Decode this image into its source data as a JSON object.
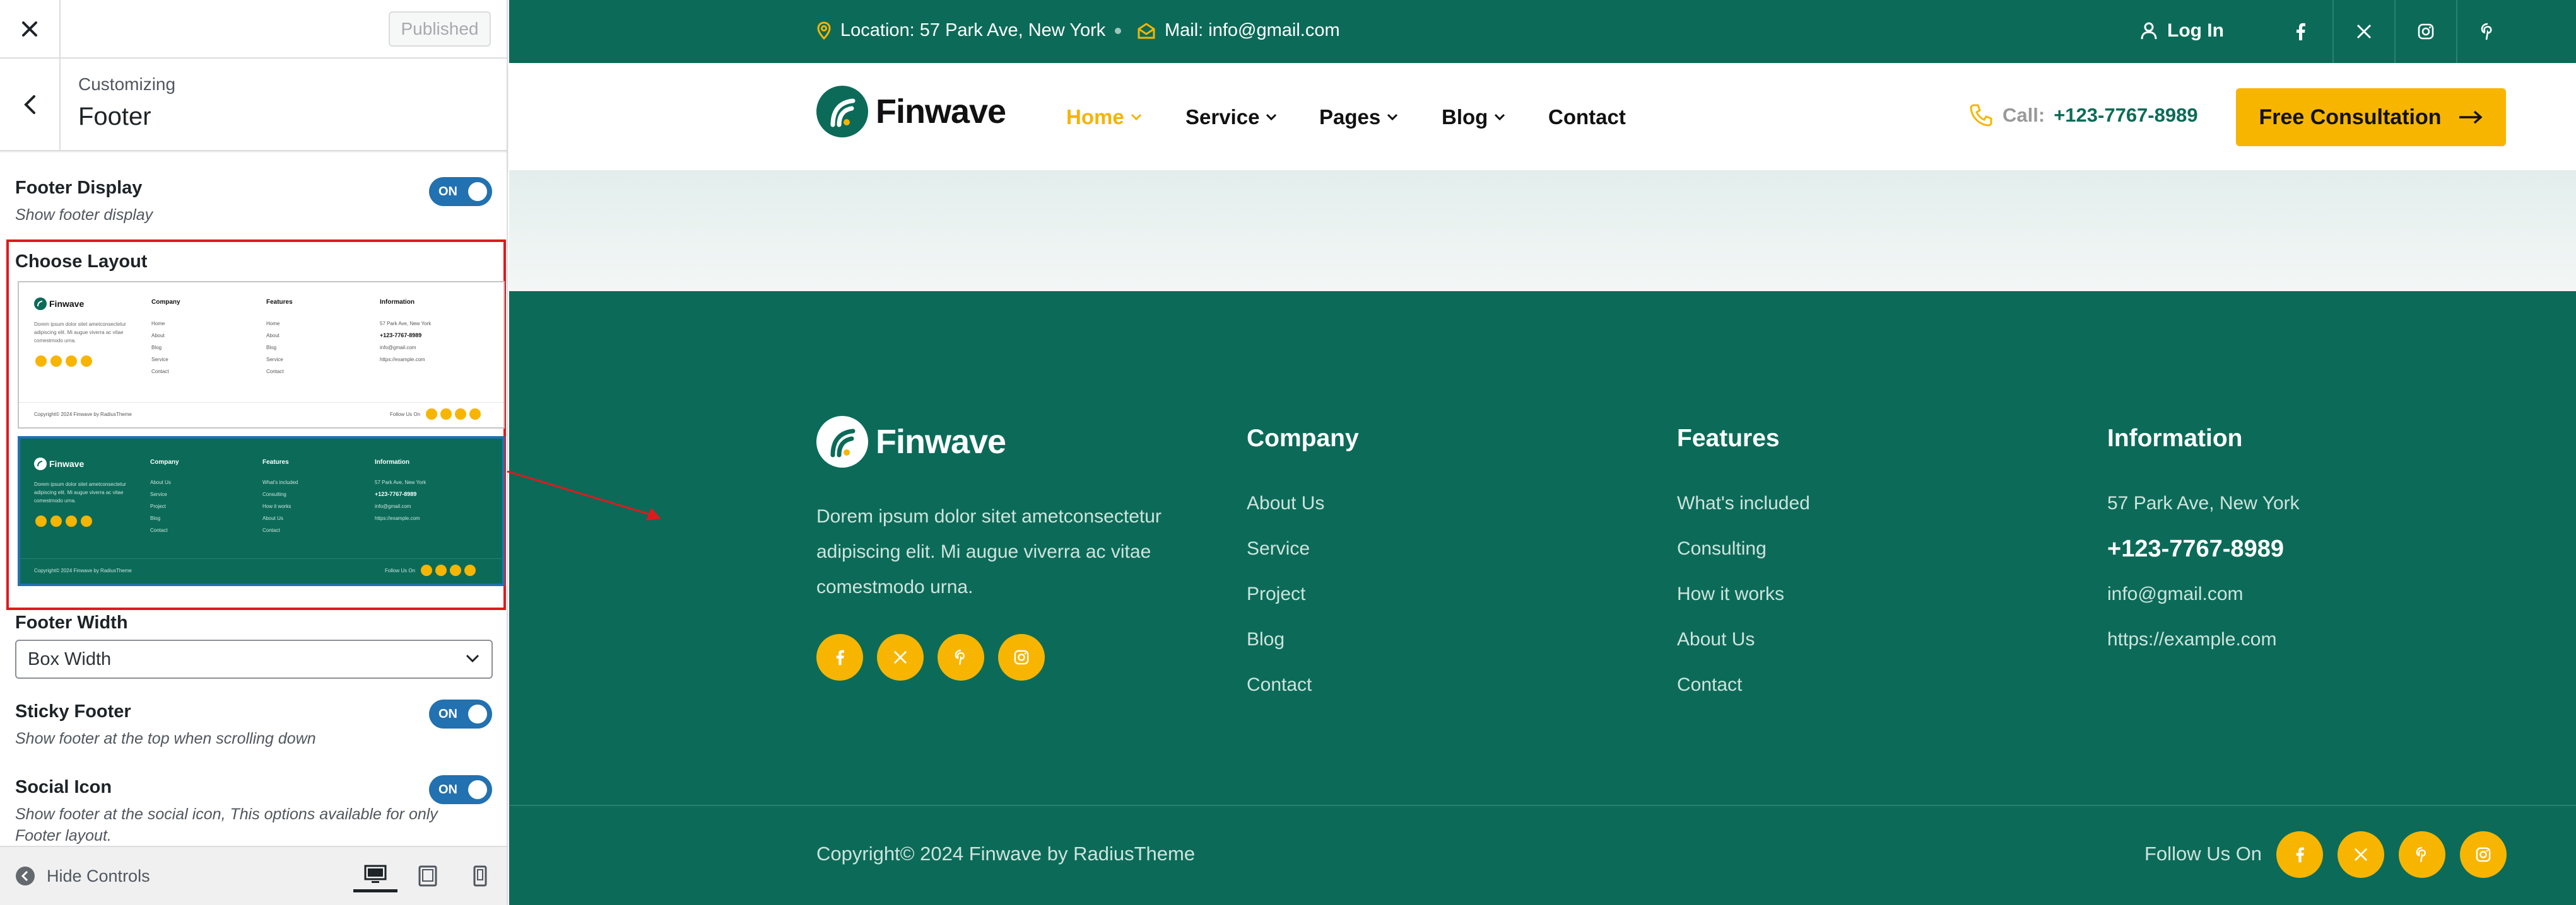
{
  "customizer": {
    "published_label": "Published",
    "breadcrumb": "Customizing",
    "section_title": "Footer",
    "options": {
      "footer_display": {
        "title": "Footer Display",
        "desc": "Show footer display",
        "toggle": "ON"
      },
      "choose_layout": {
        "title": "Choose Layout"
      },
      "footer_width": {
        "title": "Footer Width",
        "value": "Box Width"
      },
      "sticky_footer": {
        "title": "Sticky Footer",
        "desc": "Show footer at the top when scrolling down",
        "toggle": "ON"
      },
      "social_icon": {
        "title": "Social Icon",
        "desc": "Show footer at the social icon, This options available for only Footer layout.",
        "toggle": "ON"
      }
    },
    "hide_controls": "Hide Controls",
    "layout_thumbs": {
      "brand": "Finwave",
      "desc": "Dorem ipsum dolor sitet ametconsectetur adipiscing elit. Mi augue viverra ac vitae comestmodo urna.",
      "col1": "Company",
      "col2": "Features",
      "col3": "Information",
      "copyright": "Copyright© 2024 Finwave by RadiusTheme",
      "follow": "Follow Us On",
      "light_col1": [
        "Home",
        "About",
        "Blog",
        "Service",
        "Contact"
      ],
      "light_col2": [
        "Home",
        "About",
        "Blog",
        "Service",
        "Contact"
      ],
      "light_col3": [
        "57 Park Ave, New York",
        "+123-7767-8989",
        "info@gmail.com",
        "https://example.com"
      ],
      "dark_col1": [
        "About Us",
        "Service",
        "Project",
        "Blog",
        "Contact"
      ],
      "dark_col2": [
        "What's included",
        "Consulting",
        "How it works",
        "About Us",
        "Contact"
      ],
      "dark_col3": [
        "57 Park Ave, New York",
        "+123-7767-8989",
        "info@gmail.com",
        "https://example.com"
      ]
    }
  },
  "site": {
    "topbar": {
      "location": "Location: 57 Park Ave, New York",
      "mail": "Mail: info@gmail.com",
      "login": "Log In"
    },
    "brand": "Finwave",
    "nav": [
      "Home",
      "Service",
      "Pages",
      "Blog",
      "Contact"
    ],
    "call_label": "Call:",
    "call_number": "+123-7767-8989",
    "cta": "Free Consultation",
    "footer": {
      "desc": "Dorem ipsum dolor sitet ametconsectetur adipiscing elit. Mi augue viverra ac vitae comestmodo urna.",
      "company": {
        "title": "Company",
        "links": [
          "About Us",
          "Service",
          "Project",
          "Blog",
          "Contact"
        ]
      },
      "features": {
        "title": "Features",
        "links": [
          "What's included",
          "Consulting",
          "How it works",
          "About Us",
          "Contact"
        ]
      },
      "information": {
        "title": "Information",
        "address": "57 Park Ave, New York",
        "phone": "+123-7767-8989",
        "email": "info@gmail.com",
        "url": "https://example.com"
      },
      "copyright": "Copyright© 2024 Finwave by RadiusTheme",
      "follow": "Follow Us On"
    }
  },
  "colors": {
    "brand_green": "#0b6b58",
    "accent_yellow": "#f7b500",
    "toggle_blue": "#2271b1",
    "highlight_red": "#e0191d"
  },
  "icons": [
    "close-icon",
    "chevron-left-icon",
    "chevron-down-icon",
    "eye-icon",
    "desktop-icon",
    "tablet-icon",
    "mobile-icon",
    "location-pin-icon",
    "mail-icon",
    "user-icon",
    "facebook-icon",
    "x-icon",
    "instagram-icon",
    "pinterest-icon",
    "phone-icon",
    "arrow-right-icon"
  ]
}
